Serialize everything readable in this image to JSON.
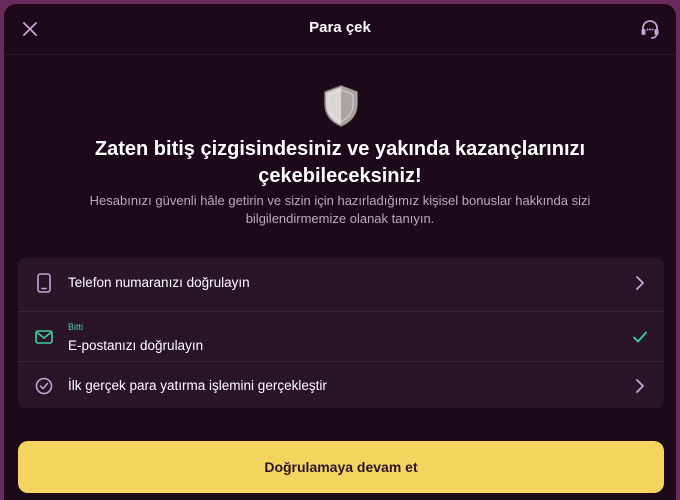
{
  "header": {
    "title": "Para çek",
    "close_icon": "close-icon",
    "support_icon": "headset-icon"
  },
  "hero": {
    "icon": "shield-icon",
    "headline": "Zaten bitiş çizgisindesiniz ve yakında kazançlarınızı çekebileceksiniz!",
    "subtext": "Hesabınızı güvenli hâle getirin ve sizin için hazırladığımız kişisel bonuslar hakkında sizi bilgilendirmemize olanak tanıyın."
  },
  "steps": [
    {
      "icon": "phone-icon",
      "label": "Telefon numaranızı doğrulayın",
      "status": "",
      "right_icon": "chevron-right-icon"
    },
    {
      "icon": "mail-icon",
      "label": "E-postanızı doğrulayın",
      "status": "Bitti",
      "right_icon": "check-icon"
    },
    {
      "icon": "check-circle-icon",
      "label": "İlk gerçek para yatırma işlemini gerçekleştir",
      "status": "",
      "right_icon": "chevron-right-icon"
    }
  ],
  "cta": {
    "label": "Doğrulamaya devam et"
  },
  "colors": {
    "background": "#1c0a1b",
    "card": "#2a1428",
    "accent_yellow": "#f5d35f",
    "success_green": "#3fd19a",
    "icon_purple": "#c9a3d6"
  }
}
